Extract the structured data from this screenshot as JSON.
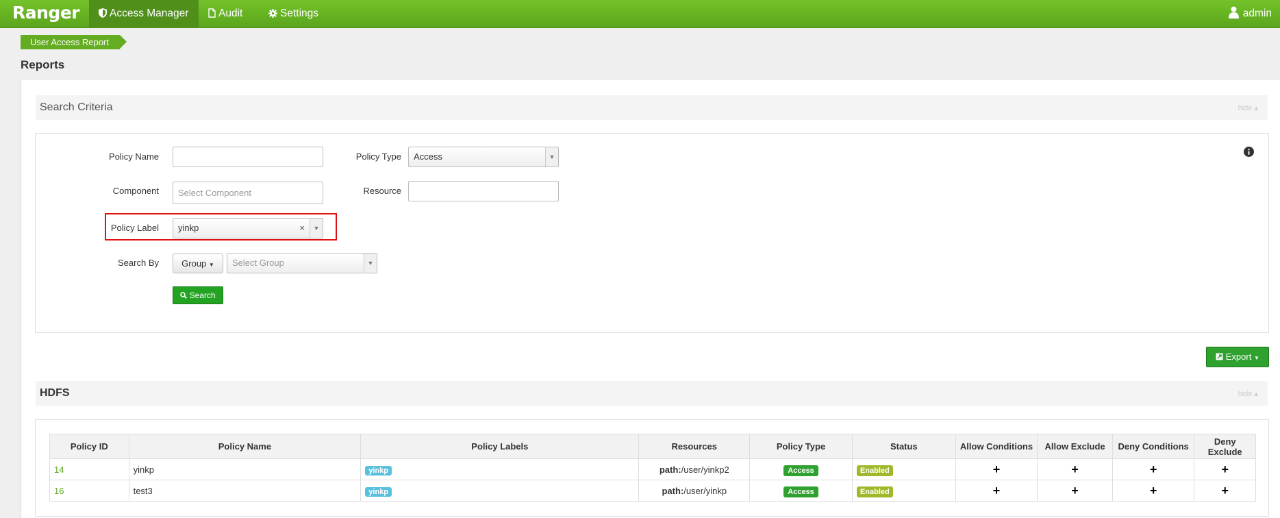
{
  "app": {
    "brand": "Ranger"
  },
  "nav": {
    "items": [
      {
        "label": "Access Manager",
        "icon": "shield-icon"
      },
      {
        "label": "Audit",
        "icon": "document-icon"
      },
      {
        "label": "Settings",
        "icon": "gear-icon"
      }
    ],
    "user": "admin"
  },
  "breadcrumb": "User Access Report",
  "page_title": "Reports",
  "criteria": {
    "title": "Search Criteria",
    "hide_label": "hide ▴",
    "policy_name_label": "Policy Name",
    "policy_name_value": "",
    "policy_type_label": "Policy Type",
    "policy_type_value": "Access",
    "component_label": "Component",
    "component_placeholder": "Select Component",
    "resource_label": "Resource",
    "resource_value": "",
    "policy_label_label": "Policy Label",
    "policy_label_value": "yinkp",
    "search_by_label": "Search By",
    "search_by_button": "Group",
    "group_placeholder": "Select Group",
    "search_button": "Search"
  },
  "export_button": "Export",
  "hdfs": {
    "title": "HDFS",
    "hide_label": "hide ▴",
    "columns": [
      "Policy ID",
      "Policy Name",
      "Policy Labels",
      "Resources",
      "Policy Type",
      "Status",
      "Allow Conditions",
      "Allow Exclude",
      "Deny Conditions",
      "Deny Exclude"
    ],
    "rows": [
      {
        "id": "14",
        "name": "yinkp",
        "label": "yinkp",
        "res_key": "path:",
        "res_val": "/user/yinkp2",
        "type": "Access",
        "status": "Enabled",
        "allow_cond": "+",
        "allow_excl": "+",
        "deny_cond": "+",
        "deny_excl": "+"
      },
      {
        "id": "16",
        "name": "test3",
        "label": "yinkp",
        "res_key": "path:",
        "res_val": "/user/yinkp",
        "type": "Access",
        "status": "Enabled",
        "allow_cond": "+",
        "allow_excl": "+",
        "deny_cond": "+",
        "deny_excl": "+"
      }
    ]
  },
  "colors": {
    "brand_green": "#5aa51c",
    "highlight_red": "#e01010",
    "label_blue": "#5bc0de",
    "enabled_olive": "#9fb92a"
  }
}
